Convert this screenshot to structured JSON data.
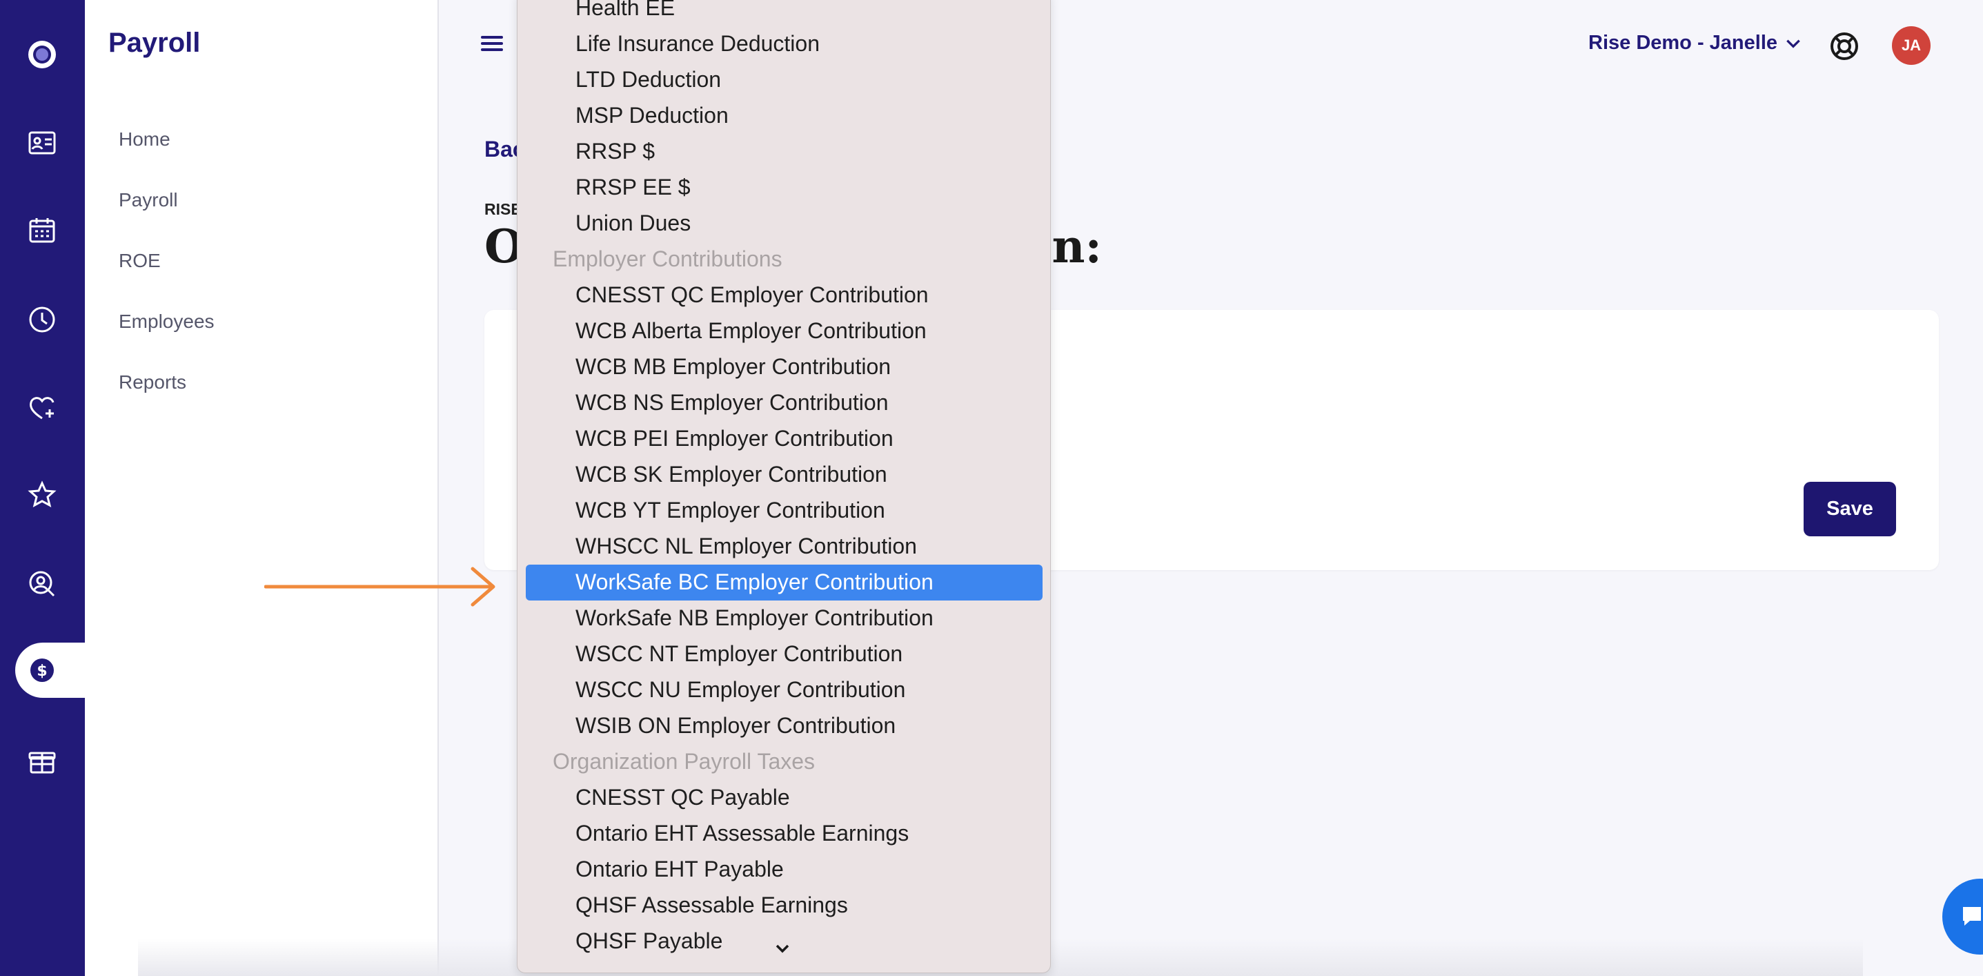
{
  "rail": {
    "icons": [
      "logo-icon",
      "id-card-icon",
      "calendar-icon",
      "clock-icon",
      "heart-plus-icon",
      "star-icon",
      "search-person-icon",
      "dollar-icon",
      "gift-box-icon"
    ],
    "active": "dollar-icon"
  },
  "subnav": {
    "title": "Payroll",
    "items": [
      {
        "label": "Home"
      },
      {
        "label": "Payroll"
      },
      {
        "label": "ROE"
      },
      {
        "label": "Employees"
      },
      {
        "label": "Reports"
      }
    ]
  },
  "header": {
    "account_label": "Rise Demo - Janelle",
    "avatar_initials": "JA"
  },
  "main": {
    "back_link": "Bac",
    "eyebrow": "RISE",
    "title_left": "O",
    "title_right": "n:",
    "save_label": "Save"
  },
  "dropdown": {
    "items": [
      {
        "type": "option",
        "label": "Health EE"
      },
      {
        "type": "option",
        "label": "Life Insurance Deduction"
      },
      {
        "type": "option",
        "label": "LTD Deduction"
      },
      {
        "type": "option",
        "label": "MSP Deduction"
      },
      {
        "type": "option",
        "label": "RRSP $"
      },
      {
        "type": "option",
        "label": "RRSP EE $"
      },
      {
        "type": "option",
        "label": "Union Dues"
      },
      {
        "type": "group",
        "label": "Employer Contributions"
      },
      {
        "type": "option",
        "label": "CNESST QC Employer Contribution"
      },
      {
        "type": "option",
        "label": "WCB Alberta Employer Contribution"
      },
      {
        "type": "option",
        "label": "WCB MB Employer Contribution"
      },
      {
        "type": "option",
        "label": "WCB NS Employer Contribution"
      },
      {
        "type": "option",
        "label": "WCB PEI Employer Contribution"
      },
      {
        "type": "option",
        "label": "WCB SK Employer Contribution"
      },
      {
        "type": "option",
        "label": "WCB YT Employer Contribution"
      },
      {
        "type": "option",
        "label": "WHSCC NL Employer Contribution"
      },
      {
        "type": "option",
        "label": "WorkSafe BC Employer Contribution",
        "selected": true
      },
      {
        "type": "option",
        "label": "WorkSafe NB Employer Contribution"
      },
      {
        "type": "option",
        "label": "WSCC NT Employer Contribution"
      },
      {
        "type": "option",
        "label": "WSCC NU Employer Contribution"
      },
      {
        "type": "option",
        "label": "WSIB ON Employer Contribution"
      },
      {
        "type": "group",
        "label": "Organization Payroll Taxes"
      },
      {
        "type": "option",
        "label": "CNESST QC Payable"
      },
      {
        "type": "option",
        "label": "Ontario EHT Assessable Earnings"
      },
      {
        "type": "option",
        "label": "Ontario EHT Payable"
      },
      {
        "type": "option",
        "label": "QHSF Assessable Earnings"
      },
      {
        "type": "option",
        "label": "QHSF Payable"
      }
    ]
  },
  "colors": {
    "rail": "#221a78",
    "brand": "#221a78",
    "selection": "#3d86ef",
    "arrow": "#f08a3c",
    "avatar": "#d0433b"
  }
}
